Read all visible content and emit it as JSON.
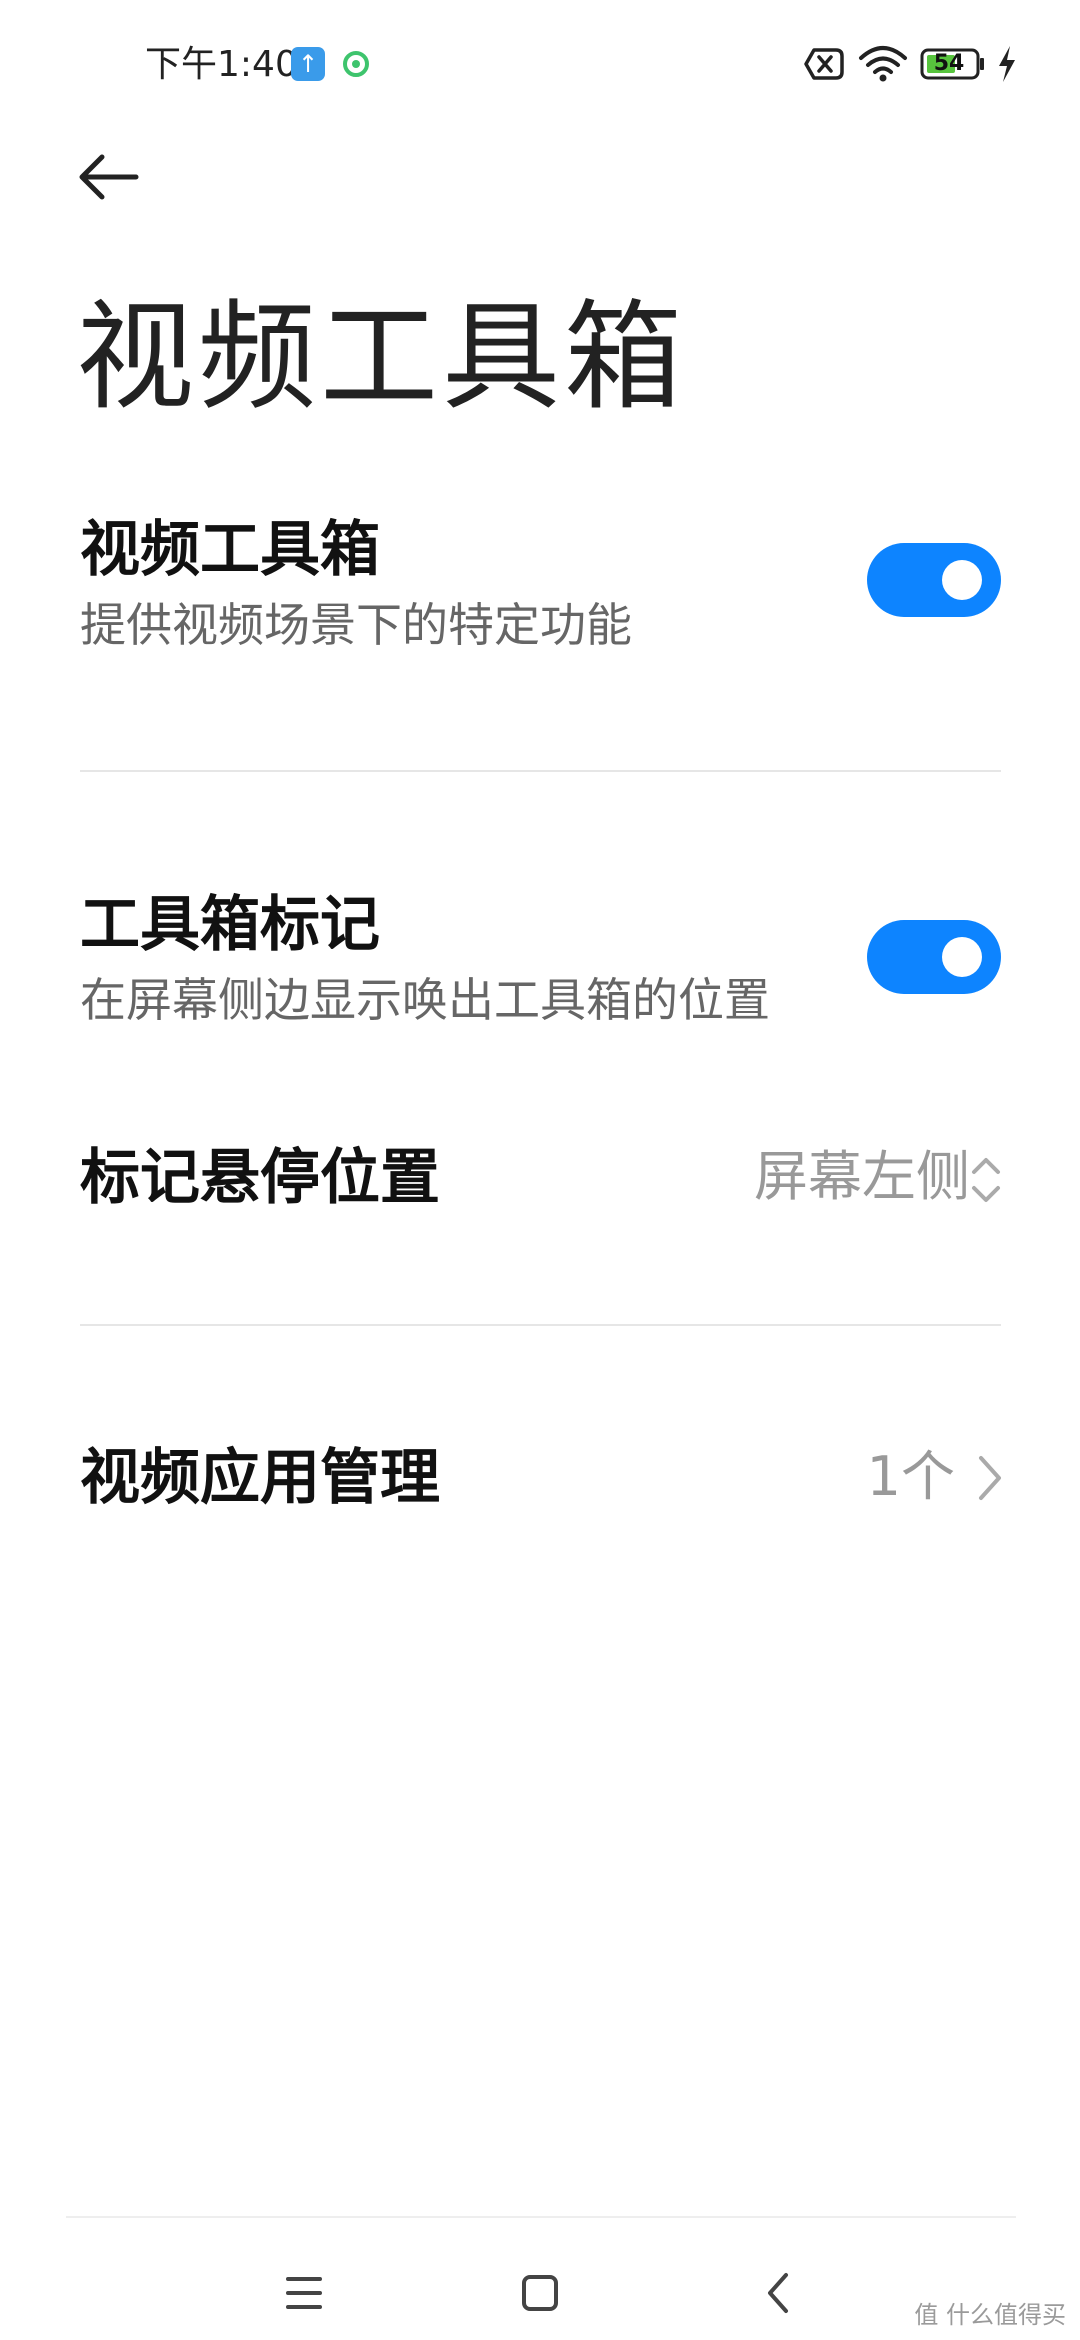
{
  "status_bar": {
    "time": "下午1:40",
    "upload_icon": "upload-arrow-icon",
    "app_icon": "green-ring-icon",
    "battery_level": "54",
    "icons": [
      "no-sim-icon",
      "wifi-icon",
      "battery-icon",
      "charging-bolt-icon"
    ]
  },
  "header": {
    "back_icon": "back-arrow-icon",
    "title": "视频工具箱"
  },
  "settings": {
    "video_toolbox": {
      "title": "视频工具箱",
      "subtitle": "提供视频场景下的特定功能",
      "enabled": true
    },
    "toolbox_marker": {
      "title": "工具箱标记",
      "subtitle": "在屏幕侧边显示唤出工具箱的位置",
      "enabled": true
    },
    "marker_position": {
      "title": "标记悬停位置",
      "value": "屏幕左侧",
      "icon": "up-down-chevron-icon"
    },
    "video_app_management": {
      "title": "视频应用管理",
      "value": "1个",
      "icon": "chevron-right-icon"
    }
  },
  "nav_bar": {
    "items": [
      "menu-icon",
      "home-icon",
      "back-icon"
    ]
  },
  "watermark": "值 什么值得买",
  "colors": {
    "accent": "#0d84ff",
    "text_primary": "#111111",
    "text_secondary": "#666666",
    "value_text": "#999999",
    "divider": "#e6e6e6"
  }
}
